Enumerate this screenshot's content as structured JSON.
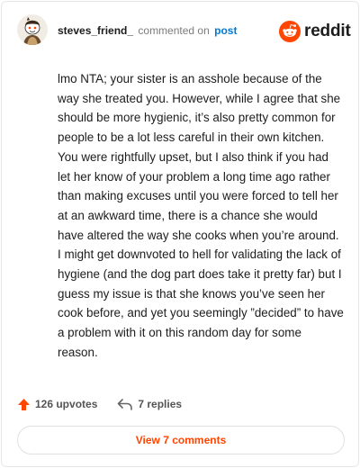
{
  "header": {
    "username": "steves_friend_",
    "action_text": "commented on",
    "post_link": "post",
    "brand": "reddit"
  },
  "comment": {
    "body": "lmo NTA; your sister is an asshole because of the way she treated you. However, while I agree that she should be more hygienic, it’s also pretty common for people to be a lot less careful in their own kitchen. You were rightfully upset, but I also think if you had let her know of your problem a long time ago rather than making excuses until you were forced to tell her at an awkward time, there is a chance she would have altered the way she cooks when you’re around. I might get downvoted to hell for validating the lack of hygiene (and the dog part does take it pretty far) but I guess my issue is that she knows you’ve seen her cook before, and yet you seemingly ”decided” to have a problem with it on this random day for some reason."
  },
  "actions": {
    "upvotes": "126 upvotes",
    "replies": "7 replies"
  },
  "footer": {
    "view_comments": "View 7 comments"
  },
  "colors": {
    "brand_orange": "#ff4500",
    "link_blue": "#0079d3",
    "muted": "#7c7c7c"
  },
  "icons": {
    "avatar": "snoo-avatar-icon",
    "brand": "reddit-logo-icon",
    "upvote": "upvote-arrow-icon",
    "reply": "reply-arrow-icon"
  }
}
